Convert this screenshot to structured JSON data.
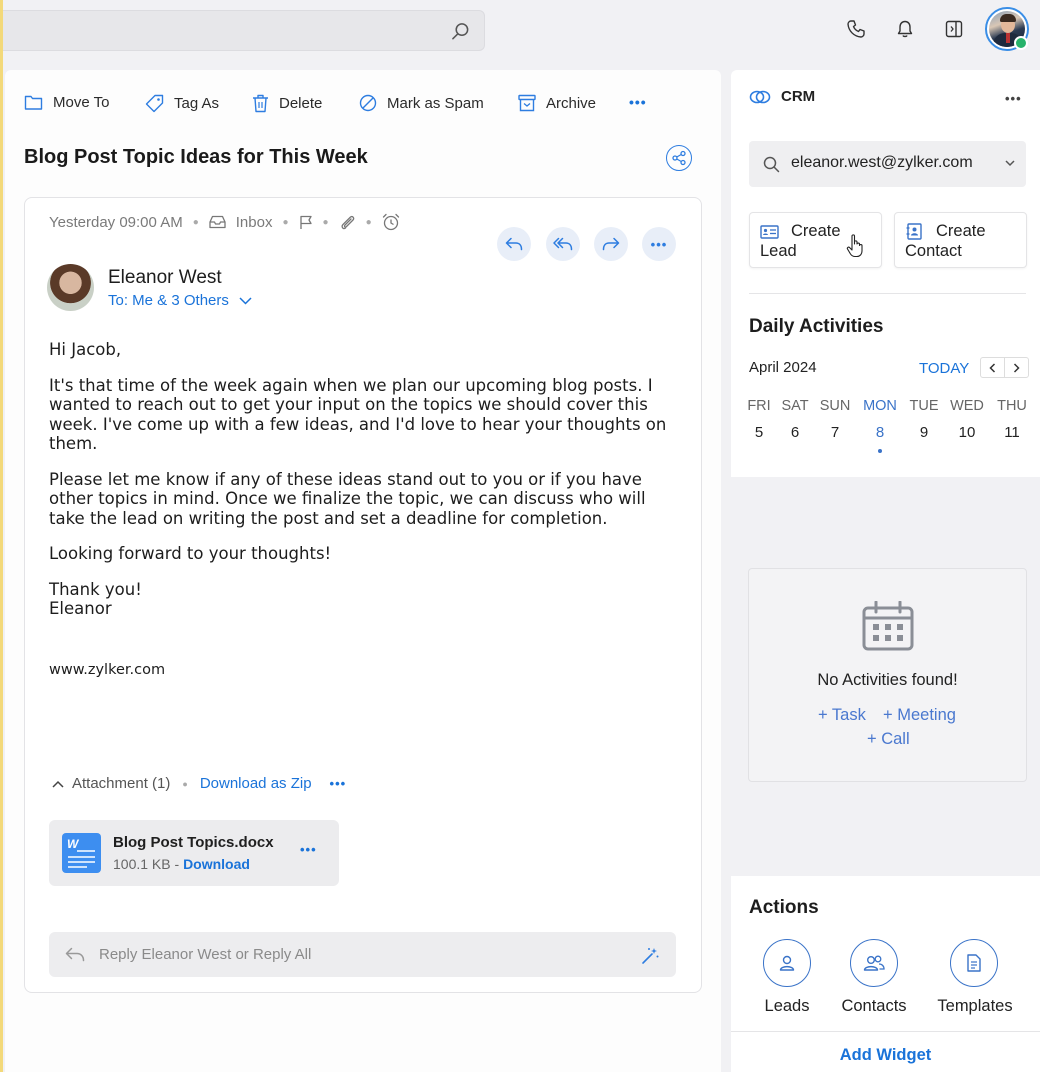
{
  "search": {
    "placeholder": ""
  },
  "toolbar": {
    "move_to": "Move To",
    "tag_as": "Tag As",
    "delete": "Delete",
    "mark_as_spam": "Mark as Spam",
    "archive": "Archive",
    "more": "•••"
  },
  "mail": {
    "subject": "Blog Post Topic Ideas for This Week",
    "timestamp": "Yesterday 09:00 AM",
    "folder": "Inbox",
    "sender_name": "Eleanor West",
    "recipients": "To: Me & 3 Others",
    "body": {
      "greeting": "Hi Jacob,",
      "para1": "It's that time of the week again when we plan our upcoming blog posts. I wanted to reach out to get your input on the topics we should cover this week. I've come up with a few ideas, and I'd love to hear your thoughts on them.",
      "para2": "Please let me know if any of these ideas stand out to you or if you have other topics in mind. Once we finalize the topic, we can discuss who will take the lead on writing the post and set a deadline for completion.",
      "para3": "Looking forward to your thoughts!",
      "signoff1": "Thank you!",
      "signoff2": "Eleanor",
      "website": "www.zylker.com"
    },
    "attachment": {
      "header": "Attachment (1)",
      "download_zip": "Download as Zip",
      "file_name": "Blog Post Topics.docx",
      "file_size": "100.1 KB",
      "file_sep": " - ",
      "file_download": "Download",
      "file_icon_letter": "W"
    },
    "reply_placeholder": "Reply Eleanor West or Reply All"
  },
  "crm": {
    "title": "CRM",
    "search_value": "eleanor.west@zylker.com",
    "create_lead_line1": "Create",
    "create_lead_line2": "Lead",
    "create_contact_line1": "Create",
    "create_contact_line2": "Contact",
    "daily_title": "Daily Activities",
    "month": "April 2024",
    "today": "TODAY",
    "days": [
      {
        "name": "FRI",
        "num": "5"
      },
      {
        "name": "SAT",
        "num": "6"
      },
      {
        "name": "SUN",
        "num": "7"
      },
      {
        "name": "MON",
        "num": "8"
      },
      {
        "name": "TUE",
        "num": "9"
      },
      {
        "name": "WED",
        "num": "10"
      },
      {
        "name": "THU",
        "num": "11"
      }
    ],
    "no_activities": "No Activities found!",
    "add_task": "+ Task",
    "add_meeting": "+ Meeting",
    "add_call": "+ Call",
    "actions_title": "Actions",
    "action_leads": "Leads",
    "action_contacts": "Contacts",
    "action_templates": "Templates",
    "add_widget": "Add Widget"
  },
  "colors": {
    "accent": "#1a73d9",
    "status_online": "#27b36b"
  }
}
